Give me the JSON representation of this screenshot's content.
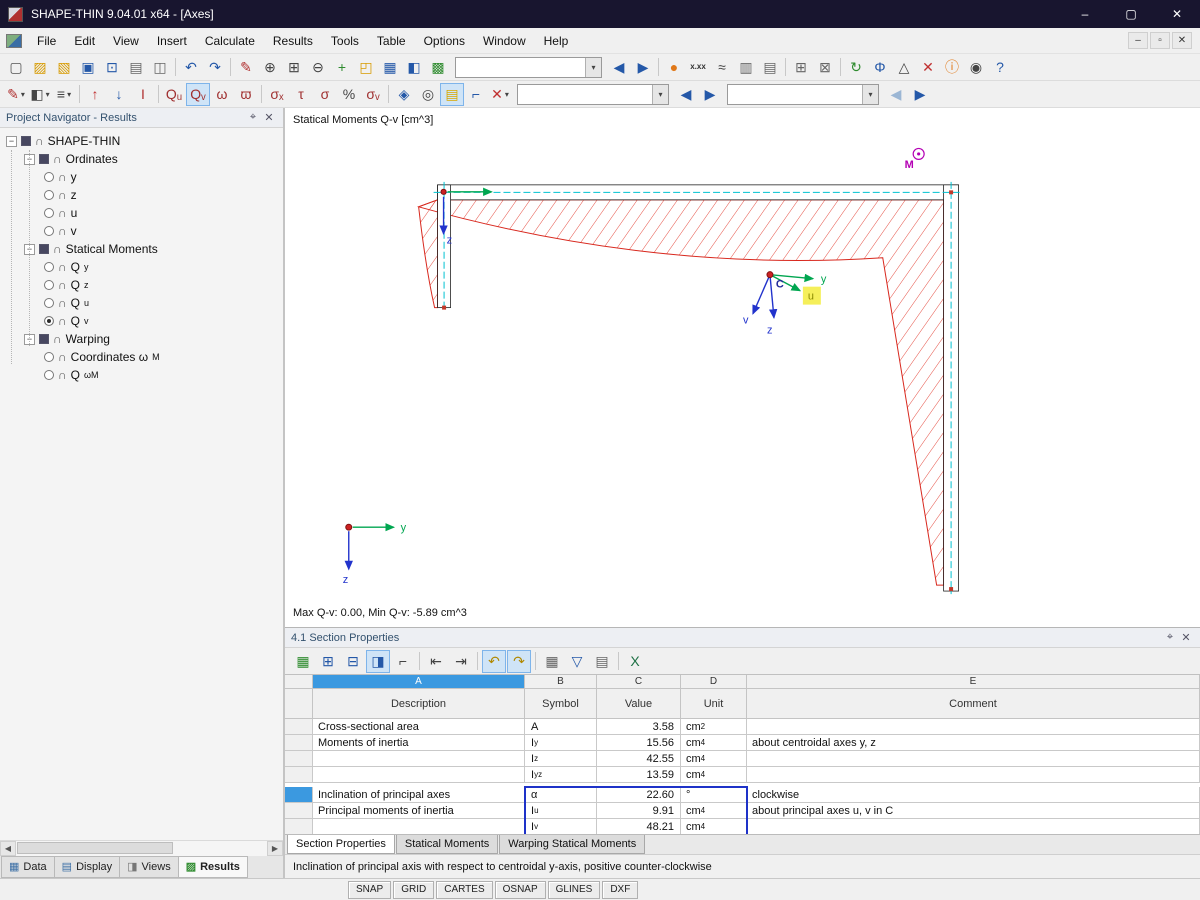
{
  "window": {
    "title": "SHAPE-THIN 9.04.01 x64 - [Axes]",
    "controls": [
      {
        "name": "minimize-button",
        "glyph": "–"
      },
      {
        "name": "maximize-button",
        "glyph": "▢"
      },
      {
        "name": "close-button",
        "glyph": "✕"
      }
    ]
  },
  "icons": {
    "caret": "▾",
    "pin": "⌖",
    "close": "✕",
    "expander": "−",
    "section": "∩",
    "scroll_left": "◀",
    "scroll_right": "▶"
  },
  "menu": {
    "items": [
      {
        "label": "File",
        "name": "menu-file"
      },
      {
        "label": "Edit",
        "name": "menu-edit"
      },
      {
        "label": "View",
        "name": "menu-view"
      },
      {
        "label": "Insert",
        "name": "menu-insert"
      },
      {
        "label": "Calculate",
        "name": "menu-calculate"
      },
      {
        "label": "Results",
        "name": "menu-results"
      },
      {
        "label": "Tools",
        "name": "menu-tools"
      },
      {
        "label": "Table",
        "name": "menu-table"
      },
      {
        "label": "Options",
        "name": "menu-options"
      },
      {
        "label": "Window",
        "name": "menu-window"
      },
      {
        "label": "Help",
        "name": "menu-help"
      }
    ],
    "mdi_controls": [
      {
        "name": "mdi-minimize-button",
        "glyph": "–"
      },
      {
        "name": "mdi-restore-button",
        "glyph": "▫"
      },
      {
        "name": "mdi-close-button",
        "glyph": "✕"
      }
    ]
  },
  "toolbar1": {
    "items": [
      {
        "name": "new-file-icon",
        "glyph": "▢",
        "color": "#555555"
      },
      {
        "name": "open-file-icon",
        "glyph": "▨",
        "color": "#d79b00"
      },
      {
        "name": "import-icon",
        "glyph": "▧",
        "color": "#d79b00"
      },
      {
        "name": "save-icon",
        "glyph": "▣",
        "color": "#2458a8"
      },
      {
        "name": "save-all-icon",
        "glyph": "⊡",
        "color": "#2458a8"
      },
      {
        "name": "print-icon",
        "glyph": "▤",
        "color": "#666666"
      },
      {
        "name": "print-preview-icon",
        "glyph": "◫",
        "color": "#666666"
      },
      {
        "name": "separator",
        "sep": true
      },
      {
        "name": "undo-icon",
        "glyph": "↶",
        "color": "#2458a8"
      },
      {
        "name": "redo-icon",
        "glyph": "↷",
        "color": "#2458a8"
      },
      {
        "name": "separator",
        "sep": true
      },
      {
        "name": "edit-pencil-icon",
        "glyph": "✎",
        "color": "#b03030"
      },
      {
        "name": "zoom-in-icon",
        "glyph": "⊕",
        "color": "#444444"
      },
      {
        "name": "zoom-window-icon",
        "glyph": "⊞",
        "color": "#444444"
      },
      {
        "name": "zoom-out-icon",
        "glyph": "⊖",
        "color": "#444444"
      },
      {
        "name": "pan-icon",
        "glyph": "+",
        "color": "#2e8b2e"
      },
      {
        "name": "full-view-icon",
        "glyph": "◰",
        "color": "#d79b00"
      },
      {
        "name": "table-view-icon",
        "glyph": "▦",
        "color": "#2458a8"
      },
      {
        "name": "panel-view-icon",
        "glyph": "◧",
        "color": "#2458a8"
      },
      {
        "name": "render-icon",
        "glyph": "▩",
        "color": "#2e8b2e"
      },
      {
        "name": "view-combo",
        "combo": true,
        "caret": true
      },
      {
        "name": "view-back-icon",
        "glyph": "◀",
        "color": "#2458a8"
      },
      {
        "name": "view-forward-icon",
        "glyph": "▶",
        "color": "#2458a8"
      },
      {
        "name": "separator",
        "sep": true
      },
      {
        "name": "render-sphere-icon",
        "glyph": "●",
        "color": "#e07818"
      },
      {
        "name": "decimal-places-icon",
        "glyph": "x.xx",
        "color": "#333333",
        "small": true
      },
      {
        "name": "units-icon",
        "glyph": "≈",
        "color": "#444444"
      },
      {
        "name": "result-tables-icon",
        "glyph": "▥",
        "color": "#666666"
      },
      {
        "name": "printout-report-icon",
        "glyph": "▤",
        "color": "#666666"
      },
      {
        "name": "separator",
        "sep": true
      },
      {
        "name": "grid-icon",
        "glyph": "⊞",
        "color": "#666666"
      },
      {
        "name": "snap-grid-icon",
        "glyph": "⊠",
        "color": "#666666"
      },
      {
        "name": "separator",
        "sep": true
      },
      {
        "name": "rotate-icon",
        "glyph": "↻",
        "color": "#2e8b2e"
      },
      {
        "name": "phi-icon",
        "glyph": "Φ",
        "color": "#2458a8"
      },
      {
        "name": "mirror-icon",
        "glyph": "△",
        "color": "#444444"
      },
      {
        "name": "delete-icon",
        "glyph": "✕",
        "color": "#c03030"
      },
      {
        "name": "info-icon",
        "glyph": "ⓘ",
        "color": "#e07818"
      },
      {
        "name": "camera-icon",
        "glyph": "◉",
        "color": "#444444"
      },
      {
        "name": "help-icon",
        "glyph": "?",
        "color": "#2458a8"
      }
    ]
  },
  "toolbar2": {
    "items": [
      {
        "name": "format-icon",
        "glyph": "✎",
        "color": "#b03030",
        "caret": true
      },
      {
        "name": "partial-view-icon",
        "glyph": "◧",
        "color": "#444444",
        "caret": true
      },
      {
        "name": "display-properties-icon",
        "glyph": "≡",
        "color": "#444444",
        "caret": true
      },
      {
        "name": "separator",
        "sep": true
      },
      {
        "name": "go-first-icon",
        "glyph": "↑",
        "color": "#c03030"
      },
      {
        "name": "go-last-icon",
        "glyph": "↓",
        "color": "#2458a8"
      },
      {
        "name": "result-beam-icon",
        "glyph": "Ι",
        "color": "#b03030"
      },
      {
        "name": "separator",
        "sep": true
      },
      {
        "name": "result-qu-icon",
        "glyph": "Qᵤ",
        "color": "#a03030"
      },
      {
        "name": "result-qv-icon",
        "glyph": "Qᵥ",
        "color": "#a03030",
        "active": true
      },
      {
        "name": "result-omega-icon",
        "glyph": "ω",
        "color": "#a03030"
      },
      {
        "name": "result-omega-m-icon",
        "glyph": "ϖ",
        "color": "#a03030"
      },
      {
        "name": "separator",
        "sep": true
      },
      {
        "name": "stress-sigma-x-icon",
        "glyph": "σₓ",
        "color": "#a03030"
      },
      {
        "name": "stress-tau-icon",
        "glyph": "τ",
        "color": "#a03030"
      },
      {
        "name": "stress-sigma-icon",
        "glyph": "σ",
        "color": "#a03030"
      },
      {
        "name": "stress-ratio-icon",
        "glyph": "%",
        "color": "#444444"
      },
      {
        "name": "stress-sigma-v-icon",
        "glyph": "σᵥ",
        "color": "#a03030"
      },
      {
        "name": "separator",
        "sep": true
      },
      {
        "name": "isolines-icon",
        "glyph": "◈",
        "color": "#2458a8"
      },
      {
        "name": "visibility-icon",
        "glyph": "◎",
        "color": "#444444"
      },
      {
        "name": "notes-icon",
        "glyph": "▤",
        "color": "#d7a800",
        "active": true
      },
      {
        "name": "frame-icon",
        "glyph": "⌐",
        "color": "#2458a8"
      },
      {
        "name": "delete-results-icon",
        "glyph": "✕",
        "color": "#c03030",
        "caret": true
      },
      {
        "name": "results-combo",
        "combo": true,
        "lg": true,
        "caret": true
      },
      {
        "name": "combo-back-icon",
        "glyph": "◀",
        "color": "#2458a8"
      },
      {
        "name": "combo-forward-icon",
        "glyph": "▶",
        "color": "#2458a8"
      },
      {
        "name": "sections-combo",
        "combo": true,
        "lg": true,
        "caret": true
      },
      {
        "name": "sections-back-icon",
        "glyph": "◀",
        "color": "#9bb6d4"
      },
      {
        "name": "sections-forward-icon",
        "glyph": "▶",
        "color": "#2458a8"
      }
    ]
  },
  "navigator": {
    "title": "Project Navigator - Results",
    "icons": {
      "expander": "−",
      "section": "∩"
    },
    "tree": [
      {
        "name": "tree-item-shape-thin",
        "level": 0,
        "branch": true,
        "label": "SHAPE-THIN",
        "sub": ""
      },
      {
        "name": "tree-item-ordinates",
        "level": 1,
        "branch": true,
        "label": "Ordinates",
        "sub": ""
      },
      {
        "name": "tree-item-y",
        "level": 2,
        "leaf": true,
        "label": "y",
        "sub": ""
      },
      {
        "name": "tree-item-z",
        "level": 2,
        "leaf": true,
        "label": "z",
        "sub": ""
      },
      {
        "name": "tree-item-u",
        "level": 2,
        "leaf": true,
        "label": "u",
        "sub": ""
      },
      {
        "name": "tree-item-v",
        "level": 2,
        "leaf": true,
        "label": "v",
        "sub": ""
      },
      {
        "name": "tree-item-statical-moments",
        "level": 1,
        "branch": true,
        "label": "Statical Moments",
        "sub": ""
      },
      {
        "name": "tree-item-qy",
        "level": 2,
        "leaf": true,
        "label": "Q",
        "sub": "y"
      },
      {
        "name": "tree-item-qz",
        "level": 2,
        "leaf": true,
        "label": "Q",
        "sub": "z"
      },
      {
        "name": "tree-item-qu",
        "level": 2,
        "leaf": true,
        "label": "Q",
        "sub": "u"
      },
      {
        "name": "tree-item-qv",
        "level": 2,
        "leaf": true,
        "label": "Q",
        "sub": "v",
        "selected": true
      },
      {
        "name": "tree-item-warping",
        "level": 1,
        "branch": true,
        "label": "Warping",
        "sub": ""
      },
      {
        "name": "tree-item-coordinates-wm",
        "level": 2,
        "leaf": true,
        "label": "Coordinates ω",
        "sub": "M"
      },
      {
        "name": "tree-item-qwm",
        "level": 2,
        "leaf": true,
        "label": "Q",
        "sub": "ωM"
      }
    ],
    "tabs": [
      {
        "name": "tab-data",
        "label": "Data",
        "glyph": "▦",
        "color": "#3a6ea5"
      },
      {
        "name": "tab-display",
        "label": "Display",
        "glyph": "▤",
        "color": "#3a6ea5"
      },
      {
        "name": "tab-views",
        "label": "Views",
        "glyph": "◨",
        "color": "#777777"
      },
      {
        "name": "tab-results",
        "label": "Results",
        "glyph": "▨",
        "color": "#2e8b2e",
        "active": true
      }
    ]
  },
  "drawing": {
    "view_label": "Statical Moments Q-v [cm^3]",
    "minmax": "Max Q-v: 0.00, Min Q-v: -5.89 cm^3",
    "labels": {
      "y": "y",
      "z": "z",
      "u": "u",
      "v": "v",
      "c": "C",
      "m": "M",
      "origin_y": "y",
      "origin_z": "z",
      "elem_z": "z"
    }
  },
  "section_panel": {
    "title": "4.1 Section Properties",
    "toolbar": [
      {
        "name": "table-settings-icon",
        "glyph": "▦",
        "color": "#2e8b2e"
      },
      {
        "name": "insert-row-icon",
        "glyph": "⊞",
        "color": "#2458a8"
      },
      {
        "name": "delete-row-icon",
        "glyph": "⊟",
        "color": "#2458a8"
      },
      {
        "name": "view-mode-icon",
        "glyph": "◨",
        "color": "#2458a8",
        "active": true
      },
      {
        "name": "corner-icon",
        "glyph": "⌐",
        "color": "#444444"
      },
      {
        "name": "separator",
        "sep": true
      },
      {
        "name": "first-column-icon",
        "glyph": "⇤",
        "color": "#444444"
      },
      {
        "name": "last-column-icon",
        "glyph": "⇥",
        "color": "#444444"
      },
      {
        "name": "separator",
        "sep": true
      },
      {
        "name": "jump-back-icon",
        "glyph": "↶",
        "color": "#b08800",
        "active": true
      },
      {
        "name": "jump-forward-icon",
        "glyph": "↷",
        "color": "#b08800",
        "active": true
      },
      {
        "name": "separator",
        "sep": true
      },
      {
        "name": "calculator-icon",
        "glyph": "▦",
        "color": "#666666"
      },
      {
        "name": "filter-icon",
        "glyph": "▽",
        "color": "#2458a8"
      },
      {
        "name": "statistics-icon",
        "glyph": "▤",
        "color": "#666666"
      },
      {
        "name": "separator",
        "sep": true
      },
      {
        "name": "excel-export-icon",
        "glyph": "X",
        "color": "#1e7145"
      }
    ],
    "columns": [
      {
        "letter": "A",
        "key": "desc",
        "selected": true
      },
      {
        "letter": "B",
        "key": "sym"
      },
      {
        "letter": "C",
        "key": "val"
      },
      {
        "letter": "D",
        "key": "unit"
      },
      {
        "letter": "E",
        "key": "com"
      }
    ],
    "headers": [
      {
        "label": "Description",
        "key": "desc"
      },
      {
        "label": "Symbol",
        "key": "sym"
      },
      {
        "label": "Value",
        "key": "val"
      },
      {
        "label": "Unit",
        "key": "unit"
      },
      {
        "label": "Comment",
        "key": "com"
      }
    ],
    "rows": [
      {
        "description": "Cross-sectional area",
        "symbol": "A",
        "symbol_sub": "",
        "value": "3.58",
        "unit": "cm",
        "unit_sup": "2",
        "comment": ""
      },
      {
        "description": "Moments of inertia",
        "symbol": "I",
        "symbol_sub": "y",
        "value": "15.56",
        "unit": "cm",
        "unit_sup": "4",
        "comment": "about centroidal axes y, z"
      },
      {
        "description": "",
        "symbol": "I",
        "symbol_sub": "z",
        "value": "42.55",
        "unit": "cm",
        "unit_sup": "4",
        "comment": ""
      },
      {
        "description": "",
        "symbol": "I",
        "symbol_sub": "yz",
        "value": "13.59",
        "unit": "cm",
        "unit_sup": "4",
        "comment": ""
      },
      {
        "description": "Inclination of principal axes",
        "symbol": "α",
        "symbol_sub": "",
        "value": "22.60",
        "unit": "°",
        "unit_sup": "",
        "comment": "clockwise",
        "highlight_row": true,
        "gap_above": true
      },
      {
        "description": "Principal moments of inertia",
        "symbol": "I",
        "symbol_sub": "u",
        "value": "9.91",
        "unit": "cm",
        "unit_sup": "4",
        "comment": "about principal axes u, v in C"
      },
      {
        "description": "",
        "symbol": "I",
        "symbol_sub": "v",
        "value": "48.21",
        "unit": "cm",
        "unit_sup": "4",
        "comment": ""
      }
    ],
    "tabs": [
      {
        "name": "tab-section-properties",
        "label": "Section Properties",
        "active": true
      },
      {
        "name": "tab-statical-moments",
        "label": "Statical Moments"
      },
      {
        "name": "tab-warping-statical-moments",
        "label": "Warping Statical Moments"
      }
    ],
    "status_message": "Inclination of principal axis with respect to centroidal y-axis, positive counter-clockwise"
  },
  "statusbar": {
    "buttons": [
      {
        "name": "snap-toggle",
        "label": "SNAP"
      },
      {
        "name": "grid-toggle",
        "label": "GRID"
      },
      {
        "name": "cartes-toggle",
        "label": "CARTES"
      },
      {
        "name": "osnap-toggle",
        "label": "OSNAP"
      },
      {
        "name": "glines-toggle",
        "label": "GLINES"
      },
      {
        "name": "dxf-toggle",
        "label": "DXF"
      }
    ]
  }
}
